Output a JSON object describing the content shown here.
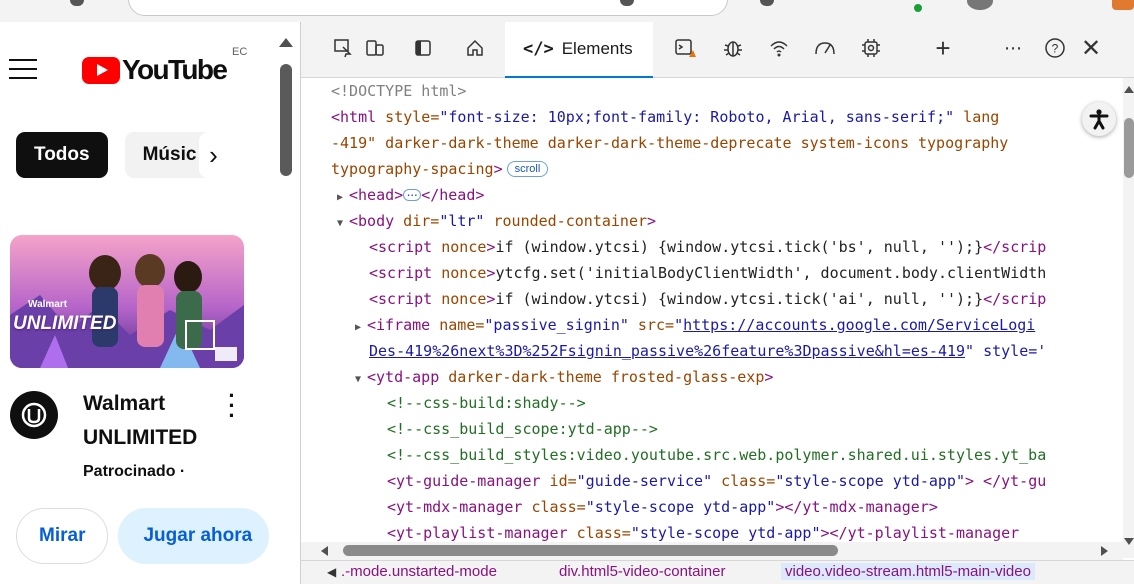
{
  "youtube": {
    "logo_text": "YouTube",
    "country_code": "EC",
    "chips": [
      "Todos",
      "Músic"
    ],
    "ad": {
      "thumb_text": "UNLIMITED",
      "thumb_brand": "Walmart",
      "title_line1": "Walmart",
      "title_line2": "UNLIMITED",
      "sponsored": "Patrocinado ·",
      "btn_watch": "Mirar",
      "btn_play": "Jugar ahora"
    }
  },
  "devtools": {
    "active_tab": "Elements",
    "active_tab_code": "</>",
    "toolbar_icons": [
      "inspect-icon",
      "device-icon",
      "sidebar-icon",
      "home-icon",
      "console-icon",
      "sources-icon",
      "network-icon",
      "performance-icon",
      "memory-icon",
      "add-icon",
      "more-icon",
      "help-icon",
      "close-icon"
    ],
    "lines": {
      "doctype": "<!DOCTYPE html>",
      "html_open_a": "<html",
      "html_attr_style": " style=",
      "html_style_val": "\"font-size: 10px;font-family: Roboto, Arial, sans-serif;\"",
      "html_attr_lang": " lang",
      "html_cont": "-419\" darker-dark-theme darker-dark-theme-deprecate system-icons typography",
      "html_cont2": "typography-spacing",
      "scroll_badge": "scroll",
      "head": "<head>",
      "head_close": "</head>",
      "body_open": "<body",
      "body_attr_dir": " dir=",
      "body_dir_val": "\"ltr\"",
      "body_attr_rc": " rounded-container",
      "script1": "if (window.ytcsi) {window.ytcsi.tick('bs', null, '');}",
      "script2": "ytcfg.set('initialBodyClientWidth', document.body.clientWidth",
      "script3": "if (window.ytcsi) {window.ytcsi.tick('ai', null, '');}",
      "script_open": "<script",
      "script_nonce": " nonce",
      "script_close": "</scrip",
      "iframe_open": "<iframe",
      "iframe_name_attr": " name=",
      "iframe_name_val": "\"passive_signin\"",
      "iframe_src_attr": " src=",
      "iframe_src_val": "https://accounts.google.com/ServiceLogi",
      "iframe_cont_link": "Des-419%26next%3D%252Fsignin_passive%26feature%3Dpassive&hl=es-419",
      "iframe_cont_rest": "\" style='",
      "ytdapp_open": "<ytd-app",
      "ytdapp_attrs": " darker-dark-theme frosted-glass-exp",
      "comment1": "<!--css-build:shady-->",
      "comment2": "<!--css_build_scope:ytd-app-->",
      "comment3": "<!--css_build_styles:video.youtube.src.web.polymer.shared.ui.styles.yt_ba",
      "guide_open": "<yt-guide-manager",
      "guide_id_attr": " id=",
      "guide_id_val": "\"guide-service\"",
      "class_attr": " class=",
      "guide_class_val": "\"style-scope ytd-app\"",
      "guide_close": " </yt-gu",
      "mdx_open": "<yt-mdx-manager",
      "mdx_class_val": "\"style-scope ytd-app\"",
      "mdx_close": "></yt-mdx-manager>",
      "playlist_open": "<yt-playlist-manager",
      "playlist_class_val": "\"style-scope ytd-app\"",
      "playlist_close": "></yt-playlist-manager"
    },
    "breadcrumbs": [
      ".-mode.unstarted-mode",
      "div.html5-video-container",
      "video.video-stream.html5-main-video"
    ]
  }
}
